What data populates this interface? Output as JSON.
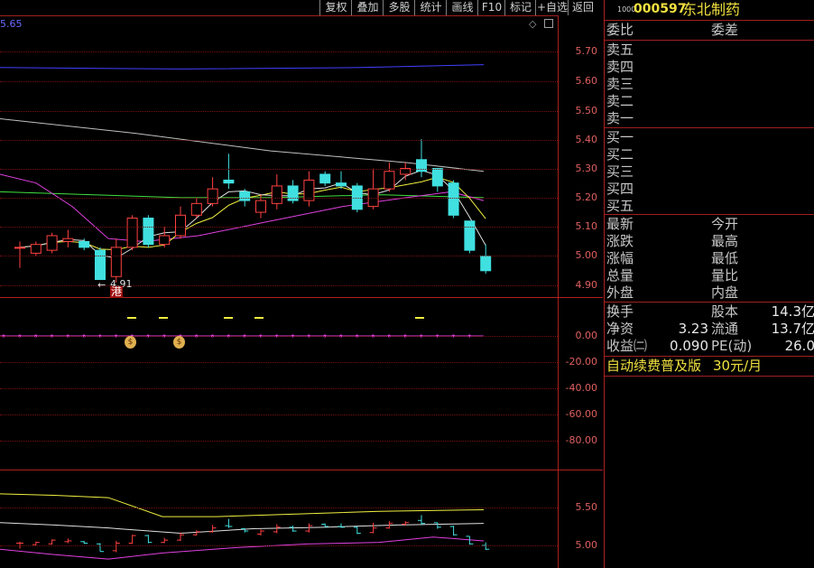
{
  "toolbar": {
    "buttons": [
      "复权",
      "叠加",
      "多股",
      "统计",
      "画线",
      "F10",
      "标记",
      "+自选",
      "返回"
    ]
  },
  "main_chart": {
    "top_label": "5.65",
    "y_labels": [
      "5.70",
      "5.60",
      "5.50",
      "5.40",
      "5.30",
      "5.20",
      "5.10",
      "5.00",
      "4.90"
    ],
    "low_marker": "4.91",
    "hk_badge": "港"
  },
  "indicator_chart": {
    "y_labels": [
      "0.00",
      "-20.00",
      "-40.00",
      "-60.00",
      "-80.00"
    ]
  },
  "bottom_chart": {
    "y_labels": [
      "5.50",
      "5.00"
    ]
  },
  "quote": {
    "code_prefix": "1000",
    "code": "000597",
    "name": "东北制药",
    "wei_bi": "委比",
    "wei_cha": "委差",
    "sells": [
      "卖五",
      "卖四",
      "卖三",
      "卖二",
      "卖一"
    ],
    "buys": [
      "买一",
      "买二",
      "买三",
      "买四",
      "买五"
    ],
    "stats_left": [
      "最新",
      "涨跌",
      "涨幅",
      "总量",
      "外盘"
    ],
    "stats_right": [
      "今开",
      "最高",
      "最低",
      "量比",
      "内盘"
    ],
    "huanshou": "换手",
    "guben": "股本",
    "guben_val": "14.3亿",
    "jingzi": "净资",
    "jingzi_val": "3.23",
    "liutong": "流通",
    "liutong_val": "13.7亿",
    "shouyi": "收益㈡",
    "shouyi_val": "0.090",
    "pe": "PE(动)",
    "pe_val": "26.0",
    "ad_text": "自动续费普及版",
    "ad_price": "30元/月"
  },
  "colors": {
    "up": "#ff4040",
    "down": "#40e0e0",
    "grid": "#7a1010",
    "ma_white": "#e0e0e0",
    "ma_yellow": "#f0f040",
    "ma_magenta": "#e040e0",
    "ma_green": "#40e040",
    "ma_blue": "#4040ff",
    "ma_gray": "#c0c0c0"
  },
  "chart_data": {
    "type": "candlestick",
    "price_range": [
      4.86,
      5.77
    ],
    "candles": [
      {
        "o": 5.03,
        "c": 5.03,
        "h": 5.05,
        "l": 4.96
      },
      {
        "o": 5.01,
        "c": 5.04,
        "h": 5.05,
        "l": 5.0
      },
      {
        "o": 5.02,
        "c": 5.07,
        "h": 5.08,
        "l": 5.01
      },
      {
        "o": 5.05,
        "c": 5.06,
        "h": 5.09,
        "l": 5.03
      },
      {
        "o": 5.05,
        "c": 5.03,
        "h": 5.06,
        "l": 5.02
      },
      {
        "o": 5.02,
        "c": 4.92,
        "h": 5.03,
        "l": 4.92
      },
      {
        "o": 4.93,
        "c": 5.03,
        "h": 5.06,
        "l": 4.91
      },
      {
        "o": 5.03,
        "c": 5.13,
        "h": 5.14,
        "l": 5.02
      },
      {
        "o": 5.13,
        "c": 5.04,
        "h": 5.14,
        "l": 5.03
      },
      {
        "o": 5.04,
        "c": 5.07,
        "h": 5.1,
        "l": 5.03
      },
      {
        "o": 5.07,
        "c": 5.14,
        "h": 5.17,
        "l": 5.06
      },
      {
        "o": 5.14,
        "c": 5.18,
        "h": 5.2,
        "l": 5.13
      },
      {
        "o": 5.18,
        "c": 5.23,
        "h": 5.27,
        "l": 5.17
      },
      {
        "o": 5.26,
        "c": 5.25,
        "h": 5.35,
        "l": 5.23
      },
      {
        "o": 5.22,
        "c": 5.19,
        "h": 5.23,
        "l": 5.17
      },
      {
        "o": 5.15,
        "c": 5.19,
        "h": 5.21,
        "l": 5.13
      },
      {
        "o": 5.18,
        "c": 5.24,
        "h": 5.28,
        "l": 5.16
      },
      {
        "o": 5.24,
        "c": 5.19,
        "h": 5.26,
        "l": 5.18
      },
      {
        "o": 5.19,
        "c": 5.26,
        "h": 5.29,
        "l": 5.17
      },
      {
        "o": 5.28,
        "c": 5.25,
        "h": 5.29,
        "l": 5.24
      },
      {
        "o": 5.25,
        "c": 5.24,
        "h": 5.29,
        "l": 5.23
      },
      {
        "o": 5.24,
        "c": 5.16,
        "h": 5.25,
        "l": 5.15
      },
      {
        "o": 5.17,
        "c": 5.23,
        "h": 5.3,
        "l": 5.16
      },
      {
        "o": 5.23,
        "c": 5.29,
        "h": 5.32,
        "l": 5.22
      },
      {
        "o": 5.28,
        "c": 5.3,
        "h": 5.32,
        "l": 5.26
      },
      {
        "o": 5.33,
        "c": 5.29,
        "h": 5.4,
        "l": 5.27
      },
      {
        "o": 5.3,
        "c": 5.24,
        "h": 5.3,
        "l": 5.22
      },
      {
        "o": 5.25,
        "c": 5.14,
        "h": 5.26,
        "l": 5.13
      },
      {
        "o": 5.12,
        "c": 5.02,
        "h": 5.12,
        "l": 5.01
      },
      {
        "o": 5.0,
        "c": 4.95,
        "h": 5.04,
        "l": 4.94
      }
    ]
  }
}
